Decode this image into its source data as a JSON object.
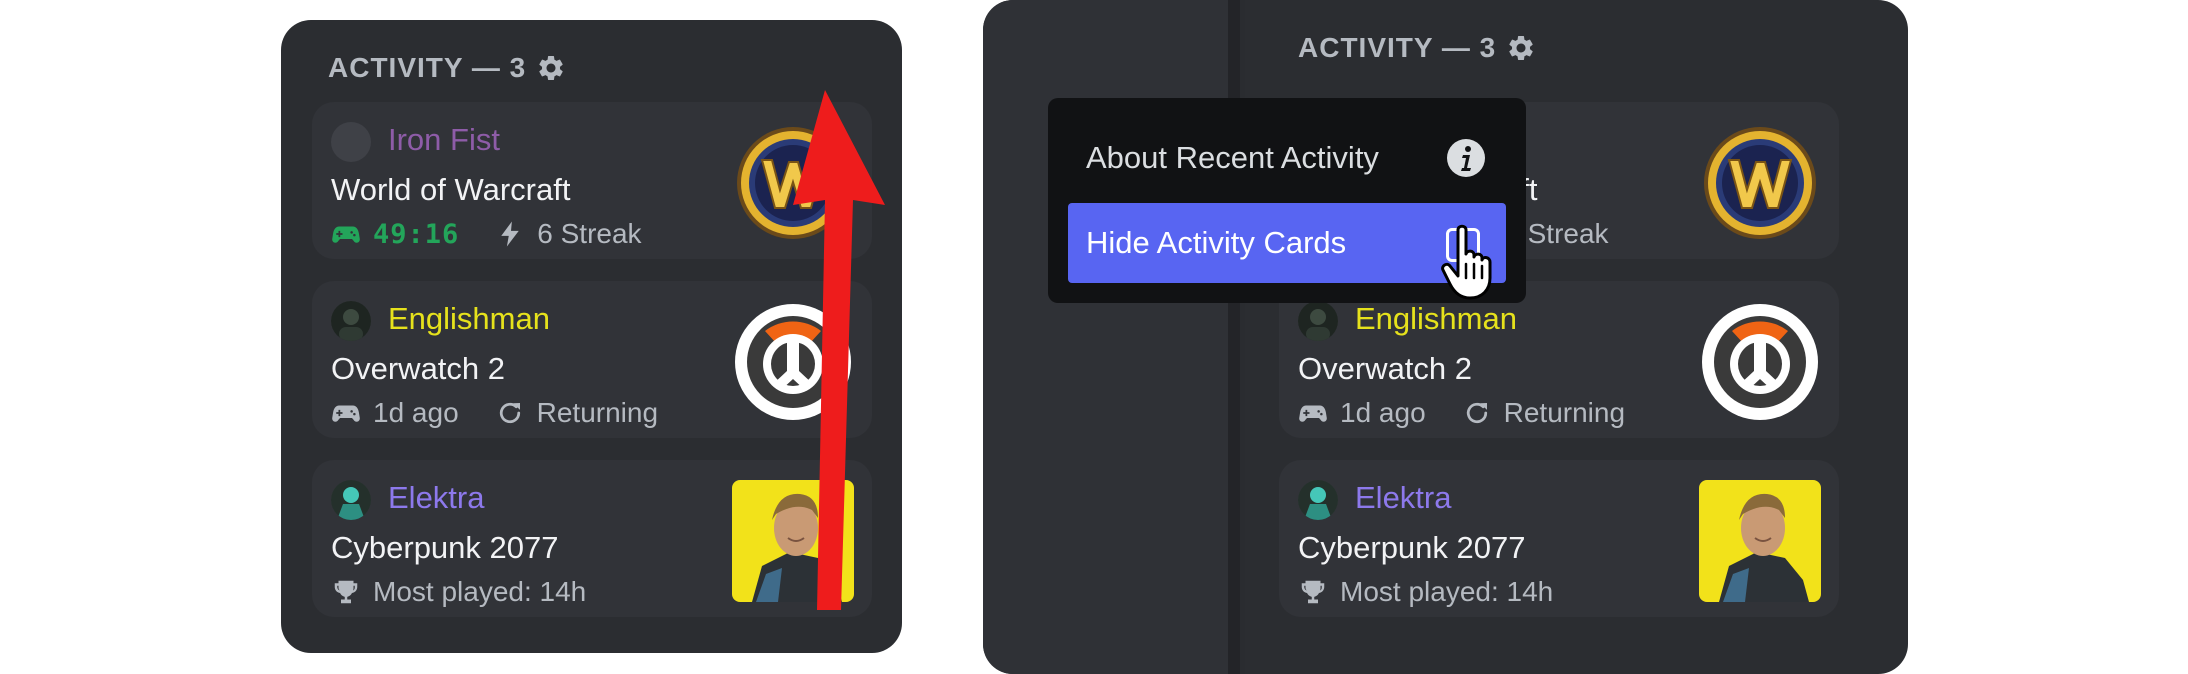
{
  "header": {
    "label": "ACTIVITY — 3"
  },
  "activities": [
    {
      "username": "Iron Fist",
      "username_color": "#8e5ca8",
      "game": "World of Warcraft",
      "meta": {
        "time": "49:16",
        "extra": "6 Streak"
      }
    },
    {
      "username": "Englishman",
      "username_color": "#e6e21c",
      "game": "Overwatch 2",
      "meta": {
        "time": "1d ago",
        "extra": "Returning"
      }
    },
    {
      "username": "Elektra",
      "username_color": "#8d79ec",
      "game": "Cyberpunk 2077",
      "meta": {
        "extra": "Most played: 14h"
      }
    }
  ],
  "menu": {
    "about_label": "About Recent Activity",
    "hide_label": "Hide Activity Cards",
    "hide_checked": false
  },
  "colors": {
    "panel_bg": "#2b2d31",
    "card_bg": "#313338",
    "accent": "#5865f2",
    "green": "#23a55a",
    "arrow": "#ee1c1c"
  },
  "icons": [
    "gear-icon",
    "controller-icon",
    "lightning-icon",
    "refresh-icon",
    "trophy-icon",
    "info-icon",
    "checkbox-icon",
    "hand-cursor-icon",
    "up-arrow-icon"
  ]
}
